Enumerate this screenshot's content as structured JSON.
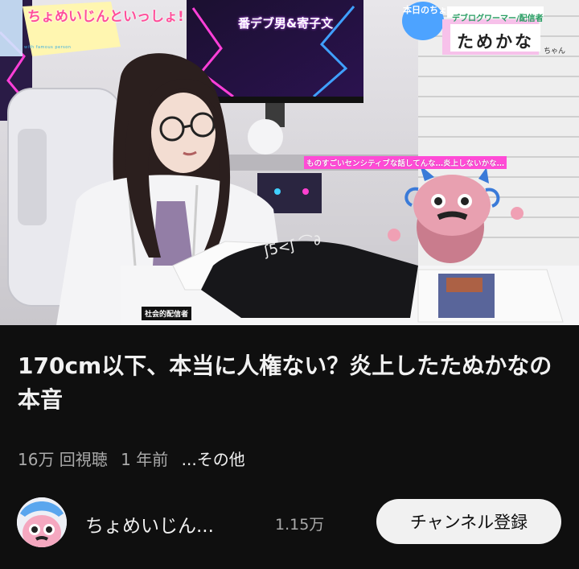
{
  "video": {
    "overlay": {
      "logo_text": "ちょめいじんといっしょ!",
      "logo_sub": "with famous person",
      "monitor_text": "番デブ男&寄子文",
      "today_badge": "本日のちょ",
      "guest_role": "デブログワーマー/配信者",
      "guest_name": "ためかな",
      "guest_suffix": "ちゃん",
      "subtitle": "ものすごいセンシティブな話してんな…炎上しないかな…",
      "tag_label": "社会的配信者"
    }
  },
  "details": {
    "title": "170cm以下、本当に人権ない？炎上したたぬかなの本音",
    "views": "16万 回視聴",
    "age": "1 年前",
    "more": "...その他"
  },
  "channel": {
    "name": "ちょめいじん...",
    "subscribers": "1.15万",
    "subscribe_label": "チャンネル登録"
  },
  "colors": {
    "background": "#0f0f0f",
    "text_primary": "#f1f1f1",
    "text_secondary": "#aaaaaa",
    "subscribe_bg": "#f1f1f1",
    "accent_pink": "#ff4bd6"
  }
}
